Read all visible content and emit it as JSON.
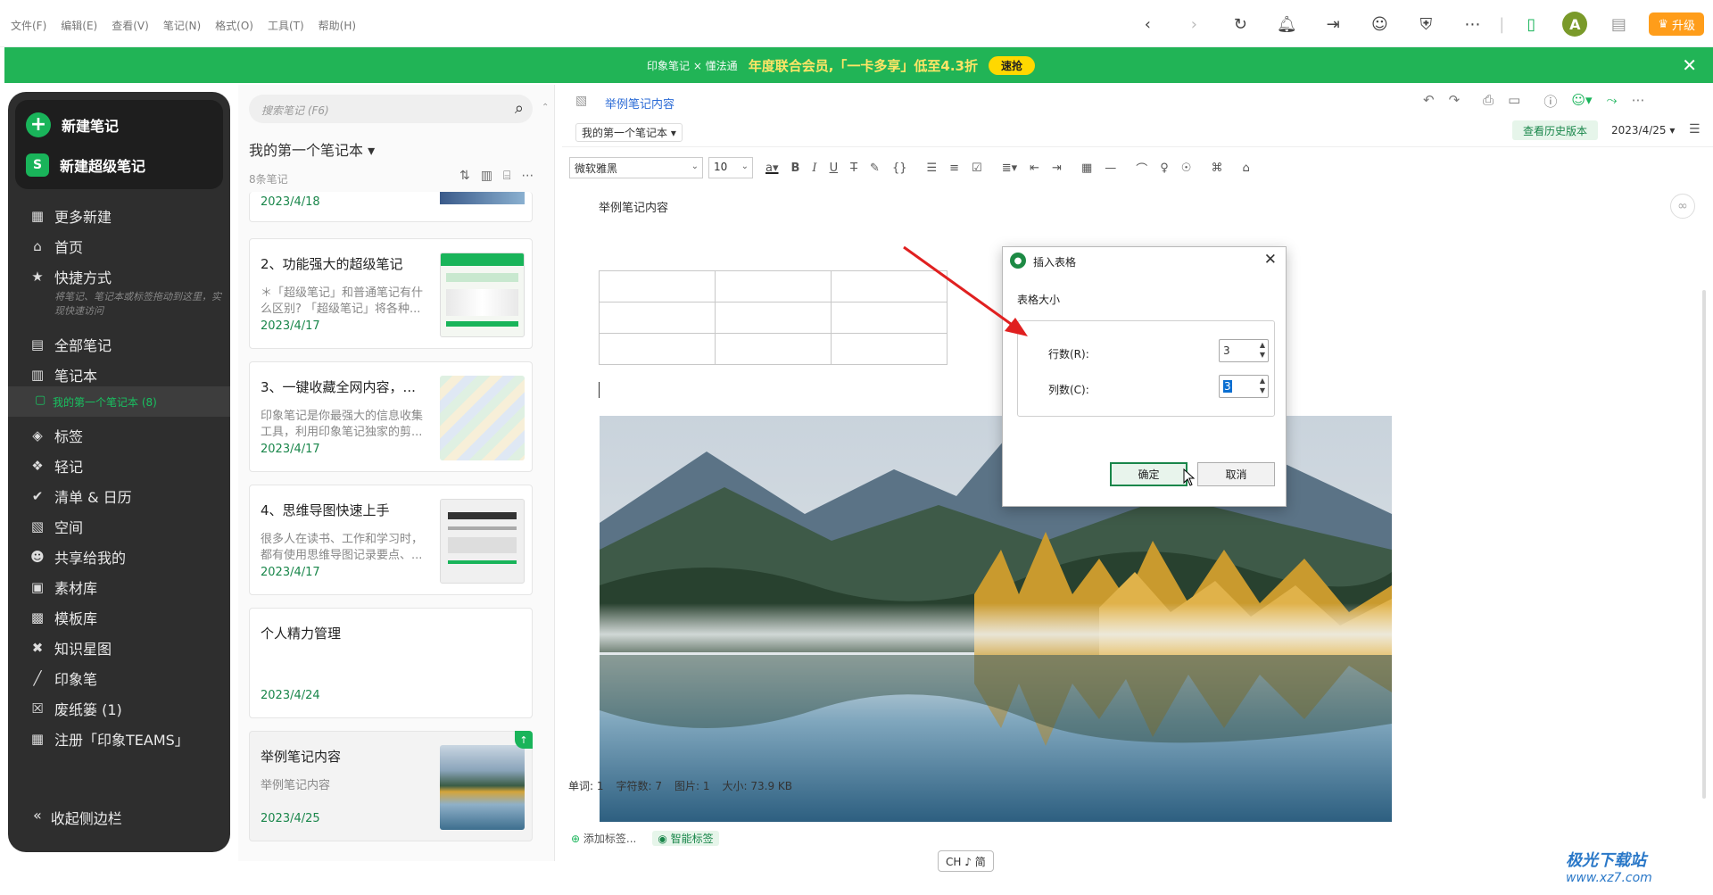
{
  "menu": [
    "文件(F)",
    "编辑(E)",
    "查看(V)",
    "笔记(N)",
    "格式(O)",
    "工具(T)",
    "帮助(H)"
  ],
  "topbar": {
    "back_icon": "chevron-left-icon",
    "forward_icon": "chevron-right-icon",
    "sync_icon": "sync-icon",
    "bell_icon": "bell-icon",
    "avatar_letter": "A",
    "upgrade_label": "升级"
  },
  "banner": {
    "brand": "印象笔记 × 懂法通",
    "text": "年度联合会员,「一卡多享」低至4.3折",
    "button": "速抢",
    "bg_color": "#21b456"
  },
  "sidebar": {
    "new_note": "新建笔记",
    "new_super_note": "新建超级笔记",
    "items": [
      {
        "label": "更多新建",
        "icon": "grid-icon"
      },
      {
        "label": "首页",
        "icon": "home-icon"
      },
      {
        "label": "快捷方式",
        "icon": "star-icon"
      },
      {
        "label": "全部笔记",
        "icon": "notes-icon"
      },
      {
        "label": "笔记本",
        "icon": "notebook-icon"
      },
      {
        "label": "标签",
        "icon": "tag-icon"
      },
      {
        "label": "轻记",
        "icon": "quick-note-icon"
      },
      {
        "label": "清单 & 日历",
        "icon": "check-icon"
      },
      {
        "label": "空间",
        "icon": "cube-icon"
      },
      {
        "label": "共享给我的",
        "icon": "people-icon"
      },
      {
        "label": "素材库",
        "icon": "library-icon"
      },
      {
        "label": "模板库",
        "icon": "template-icon"
      },
      {
        "label": "知识星图",
        "icon": "graph-icon"
      },
      {
        "label": "印象笔",
        "icon": "pen-icon"
      },
      {
        "label": "废纸篓  (1)",
        "icon": "trash-icon"
      },
      {
        "label": "注册「印象TEAMS」",
        "icon": "building-icon"
      }
    ],
    "shortcut_hint": "将笔记、笔记本或标签拖动到这里，实现快速访问",
    "active_notebook": "我的第一个笔记本  (8)",
    "collapse": "收起侧边栏"
  },
  "notelist": {
    "search_placeholder": "搜索笔记 (F6)",
    "notebook_title": "我的第一个笔记本 ▾",
    "count": "8条笔记",
    "top_date": "2023/4/18",
    "notes": [
      {
        "title": "2、功能强大的超级笔记",
        "snippet": "＊「超级笔记」和普通笔记有什么区别? 「超级笔记」将各种...",
        "date": "2023/4/17"
      },
      {
        "title": "3、一键收藏全网内容，...",
        "snippet": "印象笔记是你最强大的信息收集工具，利用印象笔记独家的剪...",
        "date": "2023/4/17"
      },
      {
        "title": "4、思维导图快速上手",
        "snippet": "很多人在读书、工作和学习时，都有使用思维导图记录要点、...",
        "date": "2023/4/17"
      },
      {
        "title": "个人精力管理",
        "snippet": "",
        "date": "2023/4/24"
      },
      {
        "title": "举例笔记内容",
        "snippet": "举例笔记内容",
        "date": "2023/4/25"
      }
    ]
  },
  "editor": {
    "note_title": "举例笔记内容",
    "notebook": "我的第一个笔记本 ▾",
    "history_btn": "查看历史版本",
    "date": "2023/4/25 ▾",
    "font": "微软雅黑",
    "size": "10",
    "body_text": "举例笔记内容",
    "add_tag": "添加标签...",
    "smart_tag": "智能标签",
    "stats": {
      "words": "单词: 1",
      "chars": "字符数: 7",
      "images": "图片: 1",
      "size": "大小: 73.9 KB"
    },
    "ime": "CH ♪ 简"
  },
  "dialog": {
    "title": "插入表格",
    "group": "表格大小",
    "rows_label": "行数(R):",
    "rows_value": "3",
    "cols_label": "列数(C):",
    "cols_value": "3",
    "ok": "确定",
    "cancel": "取消"
  },
  "watermark": {
    "line1": "极光下载站",
    "line2": "www.xz7.com"
  }
}
